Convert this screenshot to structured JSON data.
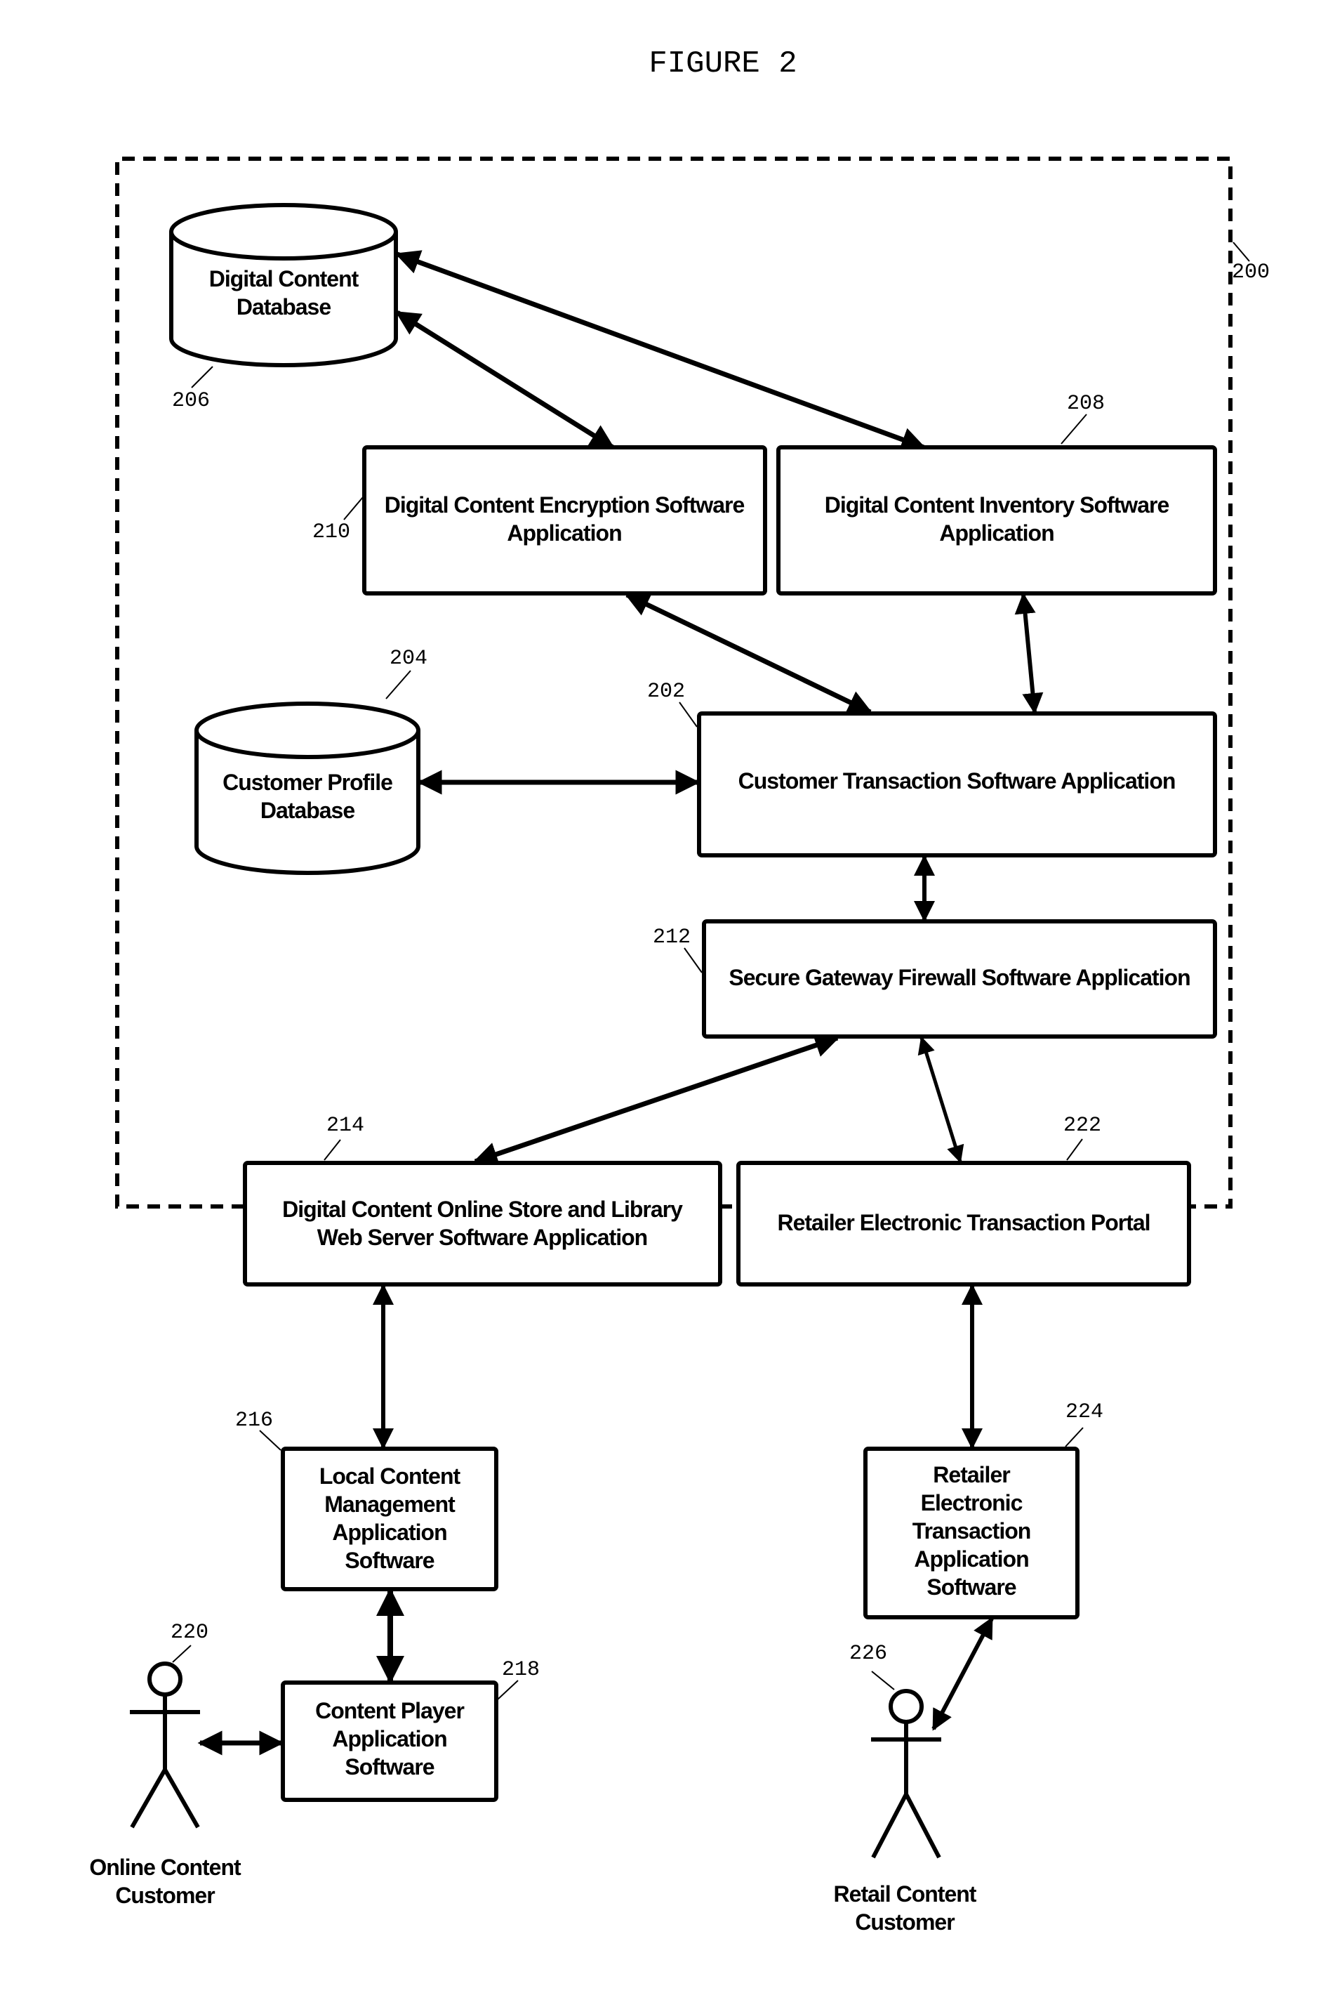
{
  "figure_title": "FIGURE 2",
  "system_boundary": {
    "ref": "200"
  },
  "nodes": {
    "digital_content_db": {
      "ref": "206",
      "lines": [
        "Digital Content",
        "Database"
      ]
    },
    "customer_profile_db": {
      "ref": "204",
      "lines": [
        "Customer Profile",
        "Database"
      ]
    },
    "encryption_app": {
      "ref": "210",
      "lines": [
        "Digital Content Encryption Software",
        "Application"
      ]
    },
    "inventory_app": {
      "ref": "208",
      "lines": [
        "Digital Content Inventory Software",
        "Application"
      ]
    },
    "customer_transaction_app": {
      "ref": "202",
      "lines": [
        "Customer Transaction Software Application"
      ]
    },
    "secure_gateway": {
      "ref": "212",
      "lines": [
        "Secure Gateway Firewall Software Application"
      ]
    },
    "online_store_web_server": {
      "ref": "214",
      "lines": [
        "Digital Content Online Store and Library",
        "Web Server Software Application"
      ]
    },
    "retailer_portal": {
      "ref": "222",
      "lines": [
        "Retailer Electronic Transaction Portal"
      ]
    },
    "local_content_mgmt": {
      "ref": "216",
      "lines": [
        "Local Content",
        "Management",
        "Application",
        "Software"
      ]
    },
    "content_player": {
      "ref": "218",
      "lines": [
        "Content Player",
        "Application",
        "Software"
      ]
    },
    "retailer_transaction_app": {
      "ref": "224",
      "lines": [
        "Retailer",
        "Electronic",
        "Transaction",
        "Application",
        "Software"
      ]
    },
    "online_customer": {
      "ref": "220",
      "lines": [
        "Online Content",
        "Customer"
      ]
    },
    "retail_customer": {
      "ref": "226",
      "lines": [
        "Retail Content",
        "Customer"
      ]
    }
  },
  "connections": [
    {
      "from": "digital_content_db",
      "to": "encryption_app",
      "type": "bidirectional"
    },
    {
      "from": "digital_content_db",
      "to": "inventory_app",
      "type": "bidirectional"
    },
    {
      "from": "encryption_app",
      "to": "customer_transaction_app",
      "type": "bidirectional"
    },
    {
      "from": "inventory_app",
      "to": "customer_transaction_app",
      "type": "bidirectional"
    },
    {
      "from": "customer_profile_db",
      "to": "customer_transaction_app",
      "type": "bidirectional"
    },
    {
      "from": "customer_transaction_app",
      "to": "secure_gateway",
      "type": "bidirectional"
    },
    {
      "from": "secure_gateway",
      "to": "online_store_web_server",
      "type": "bidirectional"
    },
    {
      "from": "secure_gateway",
      "to": "retailer_portal",
      "type": "bidirectional"
    },
    {
      "from": "online_store_web_server",
      "to": "local_content_mgmt",
      "type": "bidirectional"
    },
    {
      "from": "local_content_mgmt",
      "to": "content_player",
      "type": "bidirectional"
    },
    {
      "from": "online_customer",
      "to": "content_player",
      "type": "bidirectional"
    },
    {
      "from": "retailer_portal",
      "to": "retailer_transaction_app",
      "type": "bidirectional"
    },
    {
      "from": "retailer_transaction_app",
      "to": "retail_customer",
      "type": "bidirectional"
    }
  ]
}
